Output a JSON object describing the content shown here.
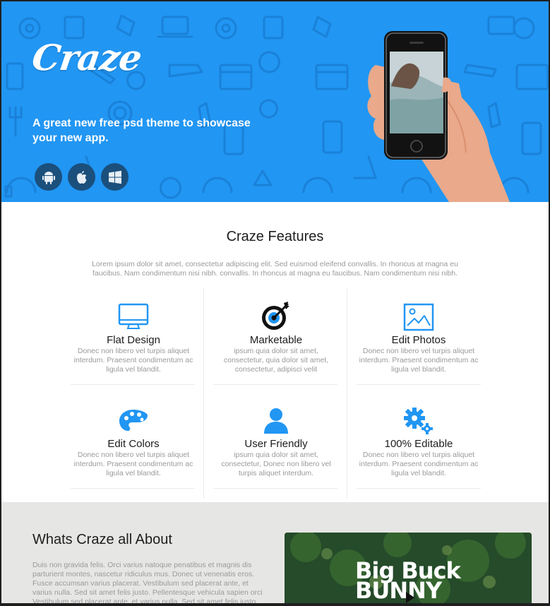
{
  "hero": {
    "logo": "Craze",
    "tagline": "A great new free psd theme to showcase your new app.",
    "platforms": [
      "android-icon",
      "apple-icon",
      "windows-icon"
    ],
    "accent": "#2196f3"
  },
  "features": {
    "title": "Craze Features",
    "intro": "Lorem ipsum dolor sit amet, consectetur adipiscing elit. Sed euismod eleifend convallis. In rhoncus at magna eu faucibus. Nam condimentum nisi nibh. convallis. In rhoncus at magna eu faucibus. Nam condimentum nisi nibh.",
    "items": [
      {
        "icon": "monitor-icon",
        "title": "Flat Design",
        "desc": "Donec non libero vel turpis aliquet interdum. Praesent condimentum ac ligula vel blandit."
      },
      {
        "icon": "target-icon",
        "title": "Marketable",
        "desc": "ipsum quia dolor sit amet, consectetur, quia dolor sit amet, consectetur, adipisci velit"
      },
      {
        "icon": "image-icon",
        "title": "Edit Photos",
        "desc": "Donec non libero vel turpis aliquet interdum. Praesent condimentum ac ligula vel blandit."
      },
      {
        "icon": "palette-icon",
        "title": "Edit Colors",
        "desc": "Donec non libero vel turpis aliquet interdum. Praesent condimentum ac ligula vel blandit."
      },
      {
        "icon": "user-icon",
        "title": "User Friendly",
        "desc": "ipsum quia dolor sit amet, consectetur, Donec non libero vel turpis aliquet interdum."
      },
      {
        "icon": "gears-icon",
        "title": "100% Editable",
        "desc": "Donec non libero vel turpis aliquet interdum. Praesent condimentum ac ligula vel blandit."
      }
    ]
  },
  "about": {
    "title": "Whats Craze all About",
    "text": "Duis non gravida felis. Orci varius natoque penatibus et magnis dis parturient montes, nascetur ridiculus mus. Donec ut venenatis eros. Fusce accumsan varius placerat. Vestibulum sed placerat ante, et varius nulla. Sed sit amet felis justo. Pellentesque vehicula sapien orci Vestibulum sed placerat ante, et varius nulla. Sed sit amet felis justo.",
    "video_title": "Big Buck BUNNY"
  }
}
